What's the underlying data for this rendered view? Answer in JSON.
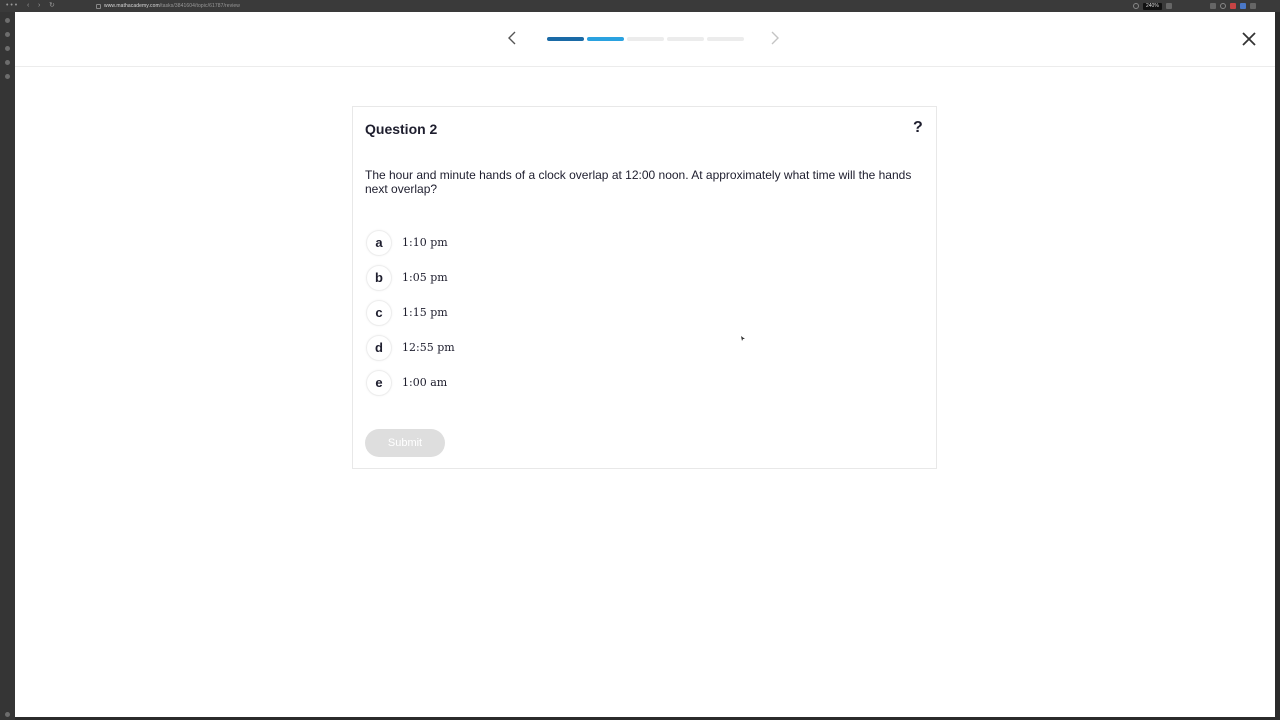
{
  "browser": {
    "url_domain": "www.mathacademy.com",
    "url_path": "/tasks/3841604/topic/61787/review",
    "zoom": "240%"
  },
  "nav": {
    "back_icon": "chevron-left-icon",
    "forward_icon": "chevron-right-icon",
    "close_icon": "close-icon",
    "progress": {
      "total": 5,
      "completed": 1,
      "current": 2
    }
  },
  "question": {
    "title": "Question 2",
    "help": "?",
    "prompt": "The hour and minute hands of a clock overlap at 12:00 noon. At approximately what time will the hands next overlap?",
    "choices": [
      {
        "letter": "a",
        "text": "1:10 pm"
      },
      {
        "letter": "b",
        "text": "1:05 pm"
      },
      {
        "letter": "c",
        "text": "1:15 pm"
      },
      {
        "letter": "d",
        "text": "12:55 pm"
      },
      {
        "letter": "e",
        "text": "1:00 am"
      }
    ],
    "submit_label": "Submit"
  },
  "colors": {
    "progress_done": "#1a6aa6",
    "progress_current": "#2aa2e0",
    "progress_empty": "#ececec",
    "submit_disabled": "#dedede"
  }
}
